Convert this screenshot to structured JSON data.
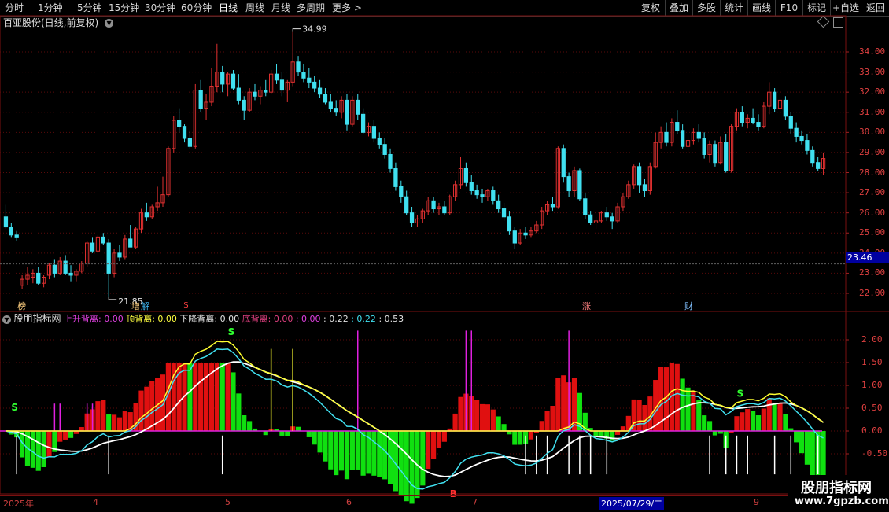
{
  "toolbar": {
    "periods": [
      "分时",
      "1分钟",
      "5分钟",
      "15分钟",
      "30分钟",
      "60分钟",
      "日线",
      "周线",
      "月线",
      "多周期",
      "更多 >"
    ],
    "active": "日线",
    "right_buttons": [
      "复权",
      "叠加",
      "多股",
      "统计",
      "画线",
      "F10",
      "标记",
      "+自选",
      "返回"
    ]
  },
  "stock_header": {
    "title": "百亚股份(日线,前复权)",
    "dropdown_icon": "chevron-down-icon"
  },
  "main_chart": {
    "y_ticks": [
      "34.00",
      "33.00",
      "32.00",
      "31.00",
      "30.00",
      "29.00",
      "28.00",
      "27.00",
      "26.00",
      "25.00",
      "24.00",
      "23.00",
      "22.00"
    ],
    "high_label": "34.99",
    "low_label": "21.85",
    "cursor_price": "23.46",
    "event_tags": [
      "榜",
      "增",
      "解",
      "$",
      "涨",
      "财"
    ],
    "up_color": "#e03030",
    "down_color": "#40e0f0"
  },
  "indicator": {
    "name": "股朋指标网",
    "items": [
      {
        "label": "上升背离: 0.00",
        "color": "#e040e0"
      },
      {
        "label": "顶背离: 0.00",
        "color": "#ffff40"
      },
      {
        "label": "下降背离: 0.00",
        "color": "#e0e0e0"
      },
      {
        "label": "底背离: 0.00",
        "color": "#e04080"
      },
      {
        "label": ": 0.00",
        "color": "#e040e0"
      },
      {
        "label": ": 0.22",
        "color": "#e0e0e0"
      },
      {
        "label": ": 0.22",
        "color": "#40e0f0"
      },
      {
        "label": ": 0.53",
        "color": "#e0e0e0"
      }
    ],
    "y_ticks": [
      "2.00",
      "1.50",
      "1.00",
      "0.50",
      "0.00",
      "-0.50"
    ],
    "signal_S": "S",
    "signal_B": "B"
  },
  "date_axis": {
    "labels": [
      "2025年",
      "4",
      "5",
      "6",
      "7",
      "2025/07/29/二",
      "9"
    ]
  },
  "watermark": {
    "title": "股朋指标网",
    "url": "www.7gpzb.com"
  },
  "chart_data": {
    "type": "candlestick",
    "title": "百亚股份(日线,前复权)",
    "price_ylim": [
      21.5,
      35.3
    ],
    "candles_ohlc": [
      [
        25.8,
        26.4,
        25.2,
        25.3
      ],
      [
        25.3,
        25.5,
        24.8,
        24.9
      ],
      [
        24.9,
        25.1,
        24.6,
        24.8
      ],
      [
        22.4,
        22.9,
        22.2,
        22.7
      ],
      [
        22.7,
        23.3,
        22.4,
        22.9
      ],
      [
        22.8,
        23.2,
        22.5,
        23.0
      ],
      [
        23.0,
        23.3,
        22.4,
        22.5
      ],
      [
        22.5,
        22.9,
        22.3,
        22.8
      ],
      [
        22.9,
        23.5,
        22.7,
        23.4
      ],
      [
        23.4,
        23.7,
        22.8,
        23.0
      ],
      [
        23.0,
        23.8,
        22.9,
        23.6
      ],
      [
        23.6,
        23.9,
        22.9,
        23.0
      ],
      [
        23.0,
        23.4,
        22.6,
        22.9
      ],
      [
        22.9,
        23.2,
        22.6,
        23.1
      ],
      [
        23.1,
        23.6,
        23.0,
        23.5
      ],
      [
        23.5,
        24.6,
        23.3,
        24.5
      ],
      [
        24.5,
        24.8,
        24.0,
        24.1
      ],
      [
        24.1,
        24.9,
        24.0,
        24.8
      ],
      [
        24.8,
        25.0,
        24.4,
        24.5
      ],
      [
        24.5,
        24.7,
        21.85,
        23.0
      ],
      [
        23.0,
        24.2,
        22.8,
        24.0
      ],
      [
        24.0,
        24.4,
        23.6,
        23.8
      ],
      [
        23.8,
        24.9,
        23.7,
        24.7
      ],
      [
        24.7,
        25.4,
        24.3,
        24.3
      ],
      [
        24.3,
        25.3,
        24.2,
        25.2
      ],
      [
        25.2,
        26.2,
        25.0,
        26.0
      ],
      [
        26.0,
        26.5,
        25.6,
        25.8
      ],
      [
        25.8,
        26.4,
        25.7,
        26.3
      ],
      [
        26.3,
        27.3,
        26.1,
        26.5
      ],
      [
        26.5,
        27.8,
        26.3,
        26.9
      ],
      [
        26.9,
        29.3,
        26.8,
        29.2
      ],
      [
        29.2,
        30.8,
        29.0,
        30.6
      ],
      [
        30.6,
        31.2,
        30.0,
        30.3
      ],
      [
        30.3,
        30.4,
        29.5,
        29.7
      ],
      [
        29.7,
        30.1,
        29.2,
        29.3
      ],
      [
        29.3,
        32.4,
        29.2,
        32.1
      ],
      [
        32.1,
        32.6,
        31.0,
        31.2
      ],
      [
        31.2,
        31.9,
        30.6,
        31.5
      ],
      [
        31.5,
        33.2,
        31.3,
        32.3
      ],
      [
        32.3,
        34.4,
        32.0,
        33.0
      ],
      [
        33.0,
        33.3,
        32.0,
        32.4
      ],
      [
        32.4,
        33.0,
        31.8,
        32.9
      ],
      [
        32.9,
        33.1,
        32.1,
        32.2
      ],
      [
        32.2,
        32.9,
        31.4,
        31.6
      ],
      [
        31.6,
        31.8,
        30.6,
        31.1
      ],
      [
        31.1,
        32.2,
        31.0,
        32.0
      ],
      [
        32.0,
        32.4,
        31.6,
        31.8
      ],
      [
        31.8,
        32.3,
        31.4,
        32.1
      ],
      [
        32.1,
        32.6,
        31.8,
        32.0
      ],
      [
        32.0,
        33.1,
        31.9,
        32.9
      ],
      [
        32.9,
        33.4,
        32.4,
        32.6
      ],
      [
        32.6,
        33.0,
        31.8,
        32.1
      ],
      [
        32.1,
        32.6,
        31.5,
        32.5
      ],
      [
        32.5,
        34.99,
        32.3,
        33.5
      ],
      [
        33.5,
        33.8,
        32.8,
        33.0
      ],
      [
        33.0,
        33.4,
        32.5,
        32.7
      ],
      [
        32.7,
        33.2,
        32.2,
        32.5
      ],
      [
        32.5,
        32.8,
        32.0,
        32.2
      ],
      [
        32.2,
        32.6,
        31.7,
        31.9
      ],
      [
        31.9,
        32.2,
        31.4,
        31.5
      ],
      [
        31.5,
        31.9,
        31.0,
        31.2
      ],
      [
        31.2,
        31.6,
        30.8,
        31.0
      ],
      [
        31.0,
        31.8,
        30.7,
        31.6
      ],
      [
        31.6,
        31.9,
        30.1,
        30.4
      ],
      [
        30.4,
        31.8,
        30.3,
        31.6
      ],
      [
        31.6,
        31.9,
        30.6,
        30.9
      ],
      [
        30.9,
        31.2,
        29.9,
        30.0
      ],
      [
        30.0,
        30.5,
        29.8,
        30.3
      ],
      [
        30.3,
        30.6,
        29.5,
        29.7
      ],
      [
        29.7,
        30.0,
        29.2,
        29.4
      ],
      [
        29.4,
        29.7,
        28.7,
        28.9
      ],
      [
        28.9,
        29.2,
        28.0,
        28.2
      ],
      [
        28.2,
        28.5,
        27.1,
        27.3
      ],
      [
        27.3,
        27.6,
        26.5,
        26.8
      ],
      [
        26.8,
        27.1,
        25.9,
        26.0
      ],
      [
        26.0,
        26.3,
        25.3,
        25.5
      ],
      [
        25.5,
        25.9,
        25.3,
        25.7
      ],
      [
        25.7,
        26.2,
        25.5,
        26.1
      ],
      [
        26.1,
        26.8,
        25.9,
        26.6
      ],
      [
        26.6,
        26.8,
        26.0,
        26.2
      ],
      [
        26.2,
        26.5,
        25.9,
        26.3
      ],
      [
        26.3,
        26.6,
        25.9,
        26.0
      ],
      [
        26.0,
        26.9,
        25.9,
        26.8
      ],
      [
        26.8,
        27.6,
        26.6,
        27.4
      ],
      [
        27.4,
        28.8,
        27.2,
        28.2
      ],
      [
        28.2,
        28.5,
        27.3,
        27.5
      ],
      [
        27.5,
        27.9,
        26.9,
        27.1
      ],
      [
        27.1,
        27.4,
        26.7,
        26.9
      ],
      [
        26.9,
        27.2,
        26.5,
        26.8
      ],
      [
        26.8,
        27.2,
        26.6,
        27.1
      ],
      [
        27.1,
        27.3,
        26.4,
        26.6
      ],
      [
        26.6,
        26.9,
        26.0,
        26.2
      ],
      [
        26.2,
        26.5,
        25.6,
        25.8
      ],
      [
        25.8,
        26.1,
        24.9,
        25.1
      ],
      [
        25.1,
        25.3,
        24.2,
        24.5
      ],
      [
        24.5,
        25.2,
        24.4,
        25.0
      ],
      [
        25.0,
        25.3,
        24.7,
        24.9
      ],
      [
        24.9,
        25.3,
        24.8,
        25.1
      ],
      [
        25.1,
        25.6,
        25.0,
        25.4
      ],
      [
        25.4,
        26.3,
        25.2,
        26.1
      ],
      [
        26.1,
        26.6,
        25.9,
        26.4
      ],
      [
        26.4,
        26.8,
        26.1,
        26.3
      ],
      [
        26.3,
        29.3,
        26.2,
        29.2
      ],
      [
        29.2,
        29.4,
        27.5,
        27.8
      ],
      [
        27.8,
        28.0,
        26.8,
        27.1
      ],
      [
        27.1,
        28.3,
        26.8,
        28.1
      ],
      [
        28.1,
        28.2,
        26.6,
        26.7
      ],
      [
        26.7,
        27.0,
        25.7,
        25.9
      ],
      [
        25.9,
        26.1,
        25.4,
        25.5
      ],
      [
        25.5,
        25.8,
        25.2,
        25.6
      ],
      [
        25.6,
        26.1,
        25.5,
        26.0
      ],
      [
        26.0,
        26.3,
        25.6,
        25.8
      ],
      [
        25.8,
        26.0,
        25.2,
        25.6
      ],
      [
        25.6,
        26.5,
        25.5,
        26.3
      ],
      [
        26.3,
        27.0,
        26.1,
        26.8
      ],
      [
        26.8,
        27.6,
        26.7,
        27.4
      ],
      [
        27.4,
        28.4,
        27.2,
        28.3
      ],
      [
        28.3,
        28.5,
        27.0,
        27.4
      ],
      [
        27.4,
        27.7,
        26.8,
        27.1
      ],
      [
        27.1,
        28.5,
        26.9,
        28.3
      ],
      [
        28.3,
        30.0,
        28.2,
        29.5
      ],
      [
        29.5,
        30.3,
        29.2,
        30.0
      ],
      [
        30.0,
        30.5,
        29.3,
        29.5
      ],
      [
        29.5,
        30.7,
        29.3,
        30.5
      ],
      [
        30.5,
        31.1,
        29.9,
        30.1
      ],
      [
        30.1,
        30.4,
        29.2,
        29.3
      ],
      [
        29.3,
        29.8,
        29.0,
        29.6
      ],
      [
        29.6,
        30.2,
        29.4,
        30.0
      ],
      [
        30.0,
        30.4,
        29.5,
        29.7
      ],
      [
        29.7,
        30.0,
        28.7,
        28.9
      ],
      [
        28.9,
        29.6,
        28.5,
        29.4
      ],
      [
        29.4,
        29.6,
        28.3,
        28.5
      ],
      [
        28.5,
        29.8,
        28.4,
        29.5
      ],
      [
        29.5,
        29.9,
        28.0,
        28.1
      ],
      [
        28.1,
        30.4,
        28.0,
        30.3
      ],
      [
        30.3,
        31.2,
        30.1,
        31.0
      ],
      [
        31.0,
        31.3,
        30.3,
        30.5
      ],
      [
        30.5,
        30.9,
        30.2,
        30.7
      ],
      [
        30.7,
        31.2,
        30.4,
        30.5
      ],
      [
        30.5,
        30.9,
        30.1,
        30.3
      ],
      [
        30.3,
        31.5,
        30.2,
        31.3
      ],
      [
        31.3,
        32.5,
        30.9,
        32.0
      ],
      [
        32.0,
        32.2,
        31.0,
        31.2
      ],
      [
        31.2,
        31.8,
        31.0,
        31.6
      ],
      [
        31.6,
        31.8,
        30.6,
        30.8
      ],
      [
        30.8,
        31.0,
        29.9,
        30.2
      ],
      [
        30.2,
        30.5,
        29.5,
        29.8
      ],
      [
        29.8,
        30.1,
        29.4,
        29.6
      ],
      [
        29.6,
        29.9,
        28.9,
        29.1
      ],
      [
        29.1,
        29.3,
        28.3,
        28.5
      ],
      [
        28.5,
        28.8,
        28.1,
        28.2
      ],
      [
        28.2,
        29.0,
        27.9,
        28.7
      ]
    ]
  }
}
